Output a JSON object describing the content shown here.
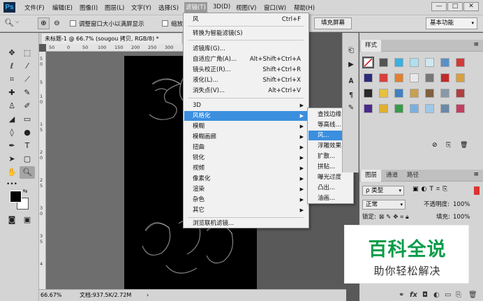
{
  "app": {
    "logo": "Ps"
  },
  "menubar": {
    "items": [
      "文件(F)",
      "编辑(E)",
      "图像(I)",
      "图层(L)",
      "文字(Y)",
      "选择(S)",
      "滤镜(T)",
      "3D(D)",
      "视图(V)",
      "窗口(W)",
      "帮助(H)"
    ],
    "active_index": 6
  },
  "window_buttons": [
    "—",
    "□",
    "✕"
  ],
  "options": {
    "resize_label": "调整窗口大小以满屏显示",
    "zoom_all_label": "缩放所有",
    "fill_screen_label": "填充屏幕",
    "workspace": "基本功能"
  },
  "document": {
    "tab_title": "未标题-1 @ 66.7% (sougou  拷贝, RGB/8) *",
    "zoom": "66.67%",
    "doc_size": "文档:937.5K/2.72M",
    "ruler_h": [
      "50",
      "0",
      "50",
      "100",
      "150",
      "200",
      "250",
      "300",
      "350",
      "400",
      "450",
      "500"
    ],
    "ruler_v": [
      "5",
      "0",
      "5",
      "1",
      "0",
      "1",
      "5",
      "2",
      "0",
      "2",
      "5",
      "3",
      "0",
      "3",
      "5",
      "4"
    ]
  },
  "filter_menu": {
    "items": [
      {
        "label": "风",
        "shortcut": "Ctrl+F"
      },
      {
        "label": "转换为智能滤镜(S)",
        "shortcut": ""
      },
      {
        "label": "滤镜库(G)...",
        "shortcut": ""
      },
      {
        "label": "自适应广角(A)...",
        "shortcut": "Alt+Shift+Ctrl+A"
      },
      {
        "label": "镜头校正(R)...",
        "shortcut": "Shift+Ctrl+R"
      },
      {
        "label": "液化(L)...",
        "shortcut": "Shift+Ctrl+X"
      },
      {
        "label": "消失点(V)...",
        "shortcut": "Alt+Ctrl+V"
      },
      {
        "label": "3D",
        "shortcut": ""
      },
      {
        "label": "风格化",
        "shortcut": ""
      },
      {
        "label": "模糊",
        "shortcut": ""
      },
      {
        "label": "模糊画廊",
        "shortcut": ""
      },
      {
        "label": "扭曲",
        "shortcut": ""
      },
      {
        "label": "锐化",
        "shortcut": ""
      },
      {
        "label": "视频",
        "shortcut": ""
      },
      {
        "label": "像素化",
        "shortcut": ""
      },
      {
        "label": "渲染",
        "shortcut": ""
      },
      {
        "label": "杂色",
        "shortcut": ""
      },
      {
        "label": "其它",
        "shortcut": ""
      },
      {
        "label": "浏览联机滤镜...",
        "shortcut": ""
      }
    ],
    "highlighted": "风格化"
  },
  "stylize_submenu": {
    "items": [
      "查找边缘",
      "等高线...",
      "风...",
      "浮雕效果...",
      "扩散...",
      "拼贴...",
      "曝光过度",
      "凸出...",
      "油画..."
    ],
    "highlighted": "风..."
  },
  "panels": {
    "styles_tab": "样式",
    "layers_tabs": [
      "图层",
      "通道",
      "路径"
    ],
    "kind_filter": "ρ 类型",
    "blend_mode": "正常",
    "opacity_label": "不透明度:",
    "opacity_value": "100%",
    "lock_label": "锁定:",
    "fill_label": "填充:",
    "fill_value": "100%"
  },
  "watermark": {
    "title": "百科全说",
    "subtitle": "助你轻松解决"
  },
  "colors": {
    "menu_highlight": "#3b8fdf",
    "watermark_green": "#0a9c49",
    "canvas": "#000000"
  }
}
